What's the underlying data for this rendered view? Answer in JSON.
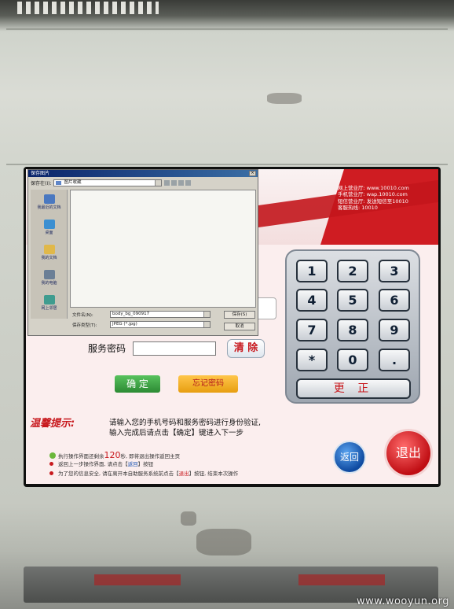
{
  "header": {
    "hotline_lines": [
      "网上营业厅: www.10010.com",
      "手机营业厅: wap.10010.com",
      "短信营业厅: 发送短信至10010",
      "客服热线: 10010"
    ]
  },
  "save_dialog": {
    "title": "保存图片",
    "save_in_label": "保存在(I):",
    "save_in_value": "图片收藏",
    "places": [
      "我最近的文档",
      "桌面",
      "我的文档",
      "我的电脑",
      "网上邻居"
    ],
    "filename_label": "文件名(N):",
    "filename_value": "body_bg_090917",
    "filetype_label": "保存类型(T):",
    "filetype_value": "JPEG (*.jpg)",
    "save_button": "保存(S)",
    "cancel_button": "取消"
  },
  "form": {
    "password_label": "服务密码",
    "clear_button": "清 除",
    "confirm_button": "确 定",
    "forgot_button": "忘记密码"
  },
  "keypad": {
    "keys": [
      "1",
      "2",
      "3",
      "4",
      "5",
      "6",
      "7",
      "8",
      "9",
      "*",
      "0",
      "."
    ],
    "correct_button": "更 正"
  },
  "tips": {
    "title": "温馨提示:",
    "line1": "请输入您的手机号码和服务密码进行身份验证,",
    "line2": "输入完成后请点击【确定】键进入下一步"
  },
  "info": {
    "countdown_pre": "执行操作界面还剩余",
    "countdown_value": "120",
    "countdown_post": "秒, 即将退出操作返回主页",
    "return_pre": "返回上一步操作界面, 请点击【",
    "return_word": "返回",
    "return_post": "】按钮",
    "exit_pre": "为了您的信息安全, 请在离开本自助服务系统前点击【",
    "exit_word": "退出",
    "exit_post": "】按钮, 结束本次操作"
  },
  "nav": {
    "back_button": "返回",
    "exit_button": "退出"
  },
  "watermark": "www.wooyun.org"
}
